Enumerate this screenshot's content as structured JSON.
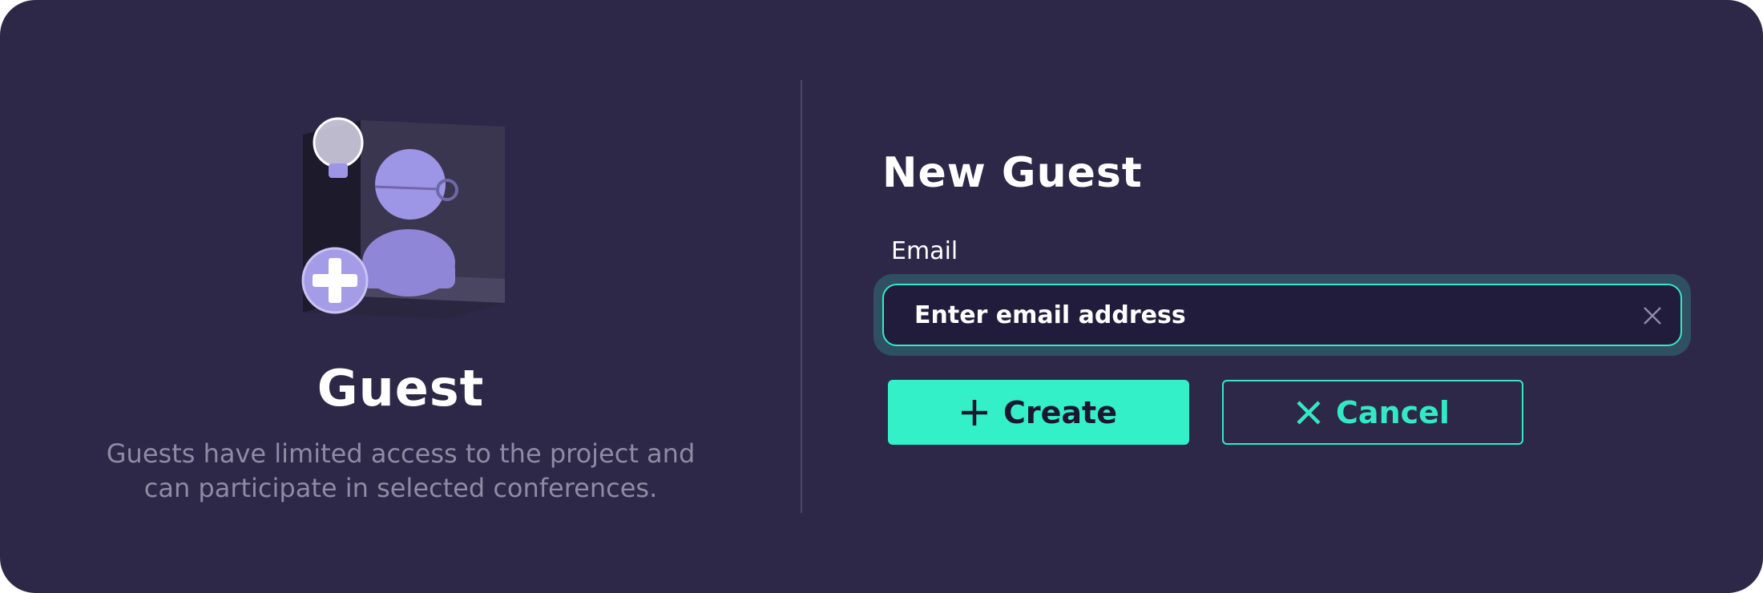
{
  "left_panel": {
    "title": "Guest",
    "description_line1": "Guests have limited access to the project and",
    "description_line2": "can participate in selected conferences.",
    "illustration": "guest-add-3d-illustration"
  },
  "form": {
    "title": "New Guest",
    "email_label": "Email",
    "email_placeholder": "Enter email address",
    "email_value": "",
    "clear_icon": "close-icon"
  },
  "actions": {
    "create_label": "Create",
    "create_icon": "plus-icon",
    "cancel_label": "Cancel",
    "cancel_icon": "close-icon"
  },
  "colors": {
    "background": "#2e2848",
    "accent": "#33f0c9",
    "muted_text": "#8f8aa6",
    "input_bg": "#221c3c"
  }
}
